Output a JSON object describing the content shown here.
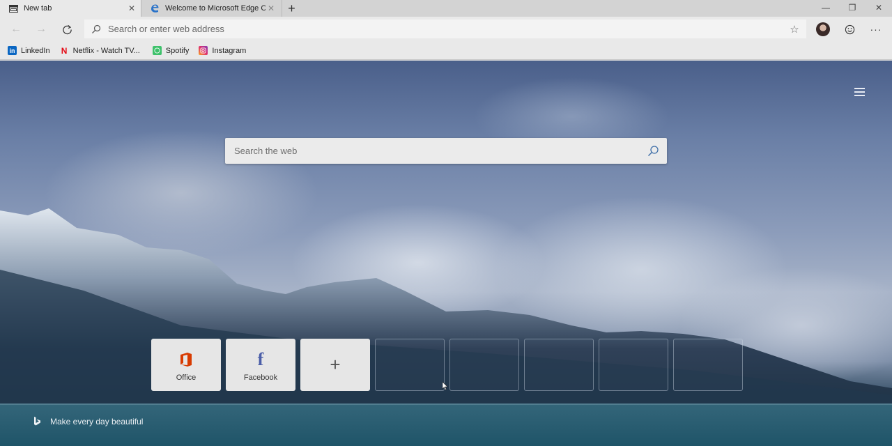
{
  "tabs": [
    {
      "label": "New tab",
      "icon": "newtab-page-icon",
      "active": true,
      "close": "✕"
    },
    {
      "label": "Welcome to Microsoft Edge Can",
      "icon": "edge-icon",
      "active": false,
      "close": "✕"
    }
  ],
  "newtab_glyph": "+",
  "window": {
    "minimize": "—",
    "restore": "❐",
    "close": "✕"
  },
  "toolbar": {
    "back": "←",
    "forward": "→",
    "address_placeholder": "Search or enter web address",
    "favorite_glyph": "☆",
    "more_glyph": "···"
  },
  "favorites": [
    {
      "label": "LinkedIn",
      "icon": "linkedin-icon",
      "glyph": "in",
      "color": "#0a66c2"
    },
    {
      "label": "Netflix - Watch TV...",
      "icon": "netflix-icon",
      "glyph": "N",
      "color": "#e50914"
    },
    {
      "label": "Spotify",
      "icon": "spotify-icon",
      "glyph": "",
      "color": "#3ec16b"
    },
    {
      "label": "Instagram",
      "icon": "instagram-icon",
      "glyph": "",
      "color": "#c13584"
    }
  ],
  "page": {
    "search_placeholder": "Search the web",
    "top_sites": [
      {
        "label": "Office",
        "icon": "office-icon",
        "color": "#d83b01"
      },
      {
        "label": "Facebook",
        "icon": "facebook-icon",
        "color": "#4b5ea8"
      }
    ],
    "add_site_glyph": "+",
    "empty_slots": 5,
    "bing_tagline": "Make every day beautiful"
  }
}
